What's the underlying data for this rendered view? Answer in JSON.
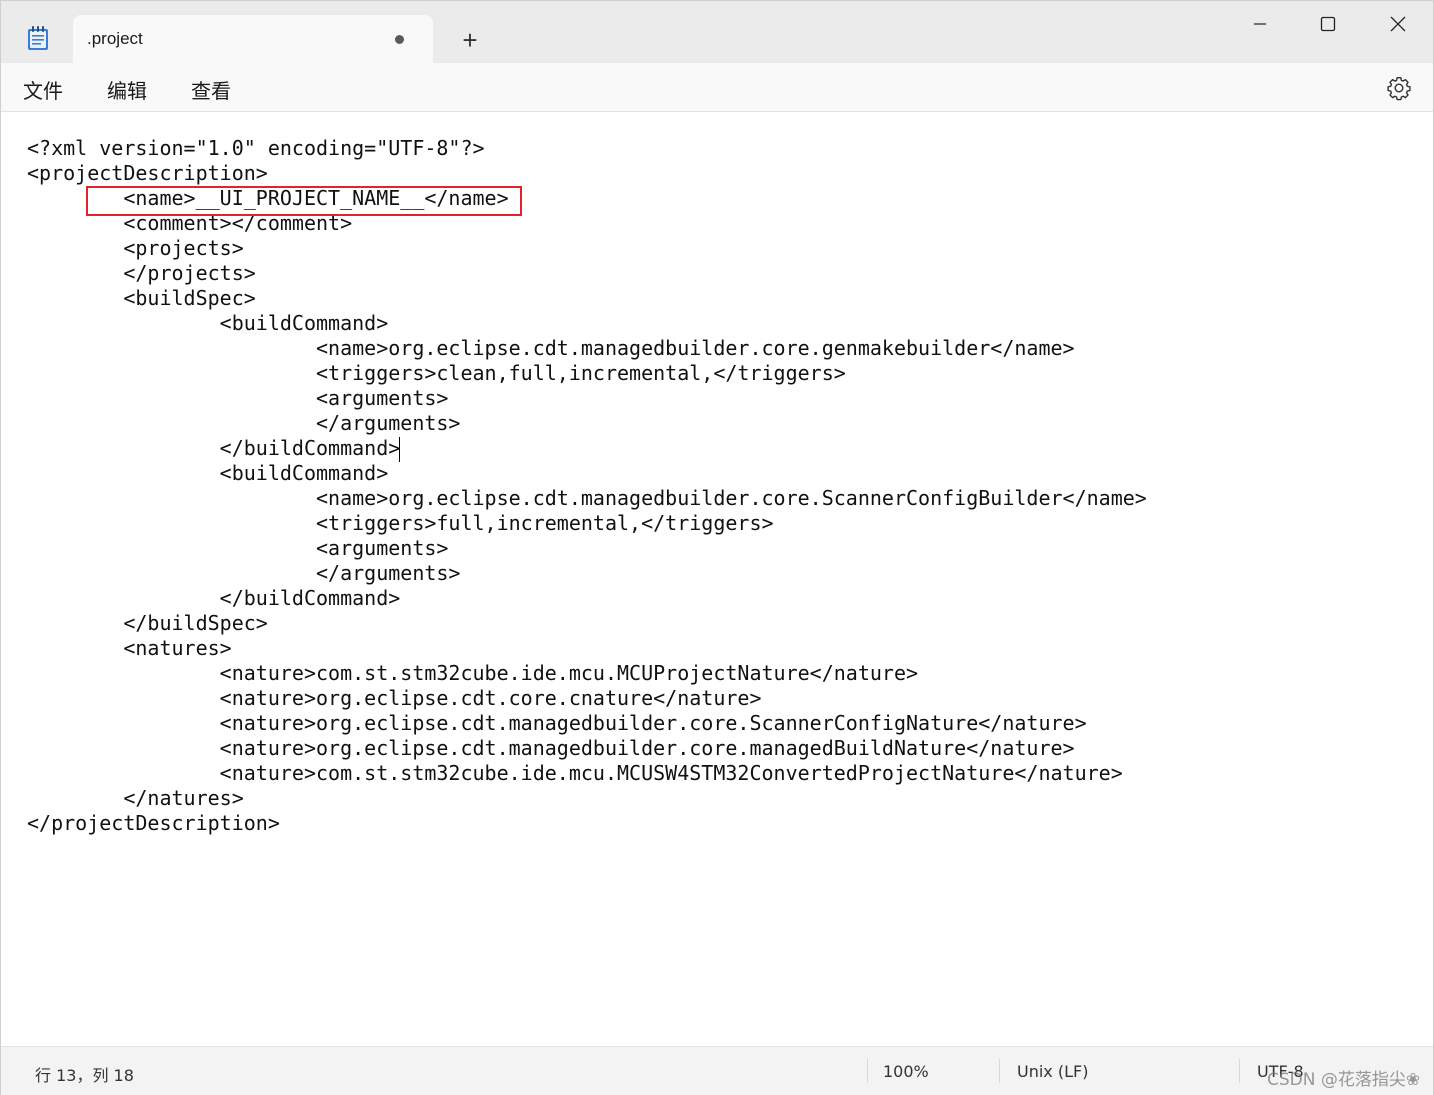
{
  "titlebar": {
    "tab_title": ".project",
    "new_tab": "+"
  },
  "menu": {
    "file": "文件",
    "edit": "编辑",
    "view": "查看"
  },
  "editor": {
    "lines": [
      "<?xml version=\"1.0\" encoding=\"UTF-8\"?>",
      "<projectDescription>",
      "        <name>__UI_PROJECT_NAME__</name>",
      "        <comment></comment>",
      "        <projects>",
      "        </projects>",
      "        <buildSpec>",
      "                <buildCommand>",
      "                        <name>org.eclipse.cdt.managedbuilder.core.genmakebuilder</name>",
      "                        <triggers>clean,full,incremental,</triggers>",
      "                        <arguments>",
      "                        </arguments>",
      "                </buildCommand>",
      "                <buildCommand>",
      "                        <name>org.eclipse.cdt.managedbuilder.core.ScannerConfigBuilder</name>",
      "                        <triggers>full,incremental,</triggers>",
      "                        <arguments>",
      "                        </arguments>",
      "                </buildCommand>",
      "        </buildSpec>",
      "        <natures>",
      "                <nature>com.st.stm32cube.ide.mcu.MCUProjectNature</nature>",
      "                <nature>org.eclipse.cdt.core.cnature</nature>",
      "                <nature>org.eclipse.cdt.managedbuilder.core.ScannerConfigNature</nature>",
      "                <nature>org.eclipse.cdt.managedbuilder.core.managedBuildNature</nature>",
      "                <nature>com.st.stm32cube.ide.mcu.MCUSW4STM32ConvertedProjectNature</nature>",
      "        </natures>",
      "</projectDescription>"
    ],
    "highlight_color": "#e0242b"
  },
  "status": {
    "position": "行 13，列 18",
    "zoom": "100%",
    "line_ending": "Unix (LF)",
    "encoding": "UTF-8"
  },
  "watermark": "CSDN @花落指尖❀"
}
